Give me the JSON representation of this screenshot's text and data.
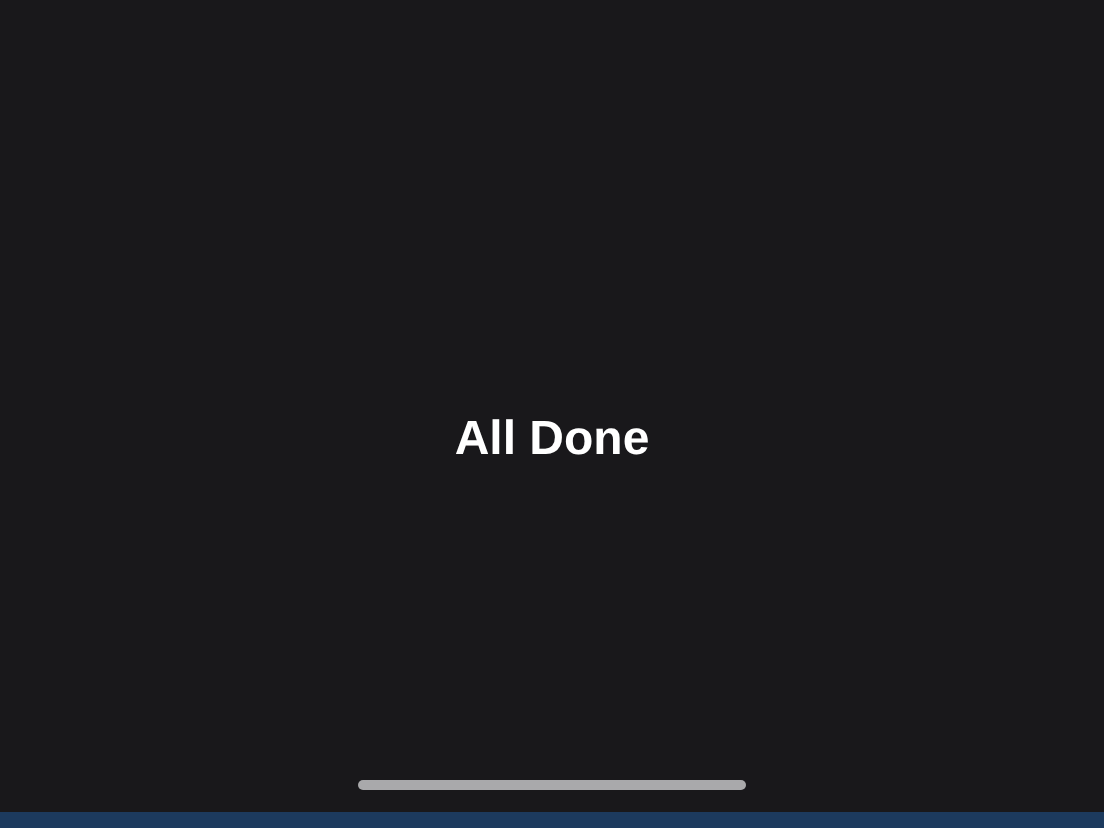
{
  "message": "All Done"
}
